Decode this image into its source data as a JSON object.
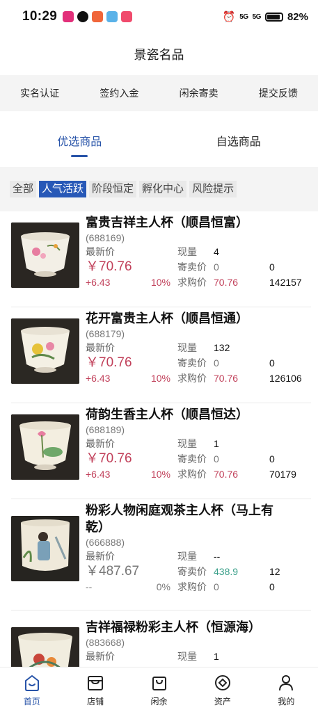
{
  "status": {
    "time": "10:29",
    "network": "5G",
    "battery": "82%"
  },
  "header": {
    "title": "景瓷名品"
  },
  "quick_actions": [
    "实名认证",
    "签约入金",
    "闲余寄卖",
    "提交反馈"
  ],
  "main_tabs": [
    "优选商品",
    "自选商品"
  ],
  "filters": [
    "全部",
    "人气活跃",
    "阶段恒定",
    "孵化中心",
    "风险提示"
  ],
  "labels": {
    "latest_price": "最新价",
    "stock": "现量",
    "consign_price": "寄卖价",
    "bid_price": "求购价"
  },
  "products": [
    {
      "name": "富贵吉祥主人杯（顺昌恒富）",
      "code": "(688169)",
      "price": "￥70.76",
      "change": "+6.43",
      "change_pct": "10%",
      "stock": "4",
      "consign_price": "0",
      "consign_qty": "0",
      "bid_price": "70.76",
      "bid_qty": "142157"
    },
    {
      "name": "花开富贵主人杯（顺昌恒通）",
      "code": "(688179)",
      "price": "￥70.76",
      "change": "+6.43",
      "change_pct": "10%",
      "stock": "132",
      "consign_price": "0",
      "consign_qty": "0",
      "bid_price": "70.76",
      "bid_qty": "126106"
    },
    {
      "name": "荷韵生香主人杯（顺昌恒达）",
      "code": "(688189)",
      "price": "￥70.76",
      "change": "+6.43",
      "change_pct": "10%",
      "stock": "1",
      "consign_price": "0",
      "consign_qty": "0",
      "bid_price": "70.76",
      "bid_qty": "70179"
    },
    {
      "name_line1": "粉彩人物闲庭观茶主人杯（马上有",
      "name_line2": "乾）",
      "code": "(666888)",
      "price": "￥487.67",
      "change": "--",
      "change_pct": "0%",
      "stock": "--",
      "consign_price": "438.9",
      "consign_qty": "12",
      "bid_price": "0",
      "bid_qty": "0"
    },
    {
      "name": "吉祥福禄粉彩主人杯（恒源海）",
      "code": "(883668)",
      "stock": "1"
    }
  ],
  "bottom_nav": [
    "首页",
    "店铺",
    "闲余",
    "资产",
    "我的"
  ],
  "colors": {
    "accent": "#2753a8",
    "up": "#c1405a",
    "teal": "#3ba08a"
  }
}
